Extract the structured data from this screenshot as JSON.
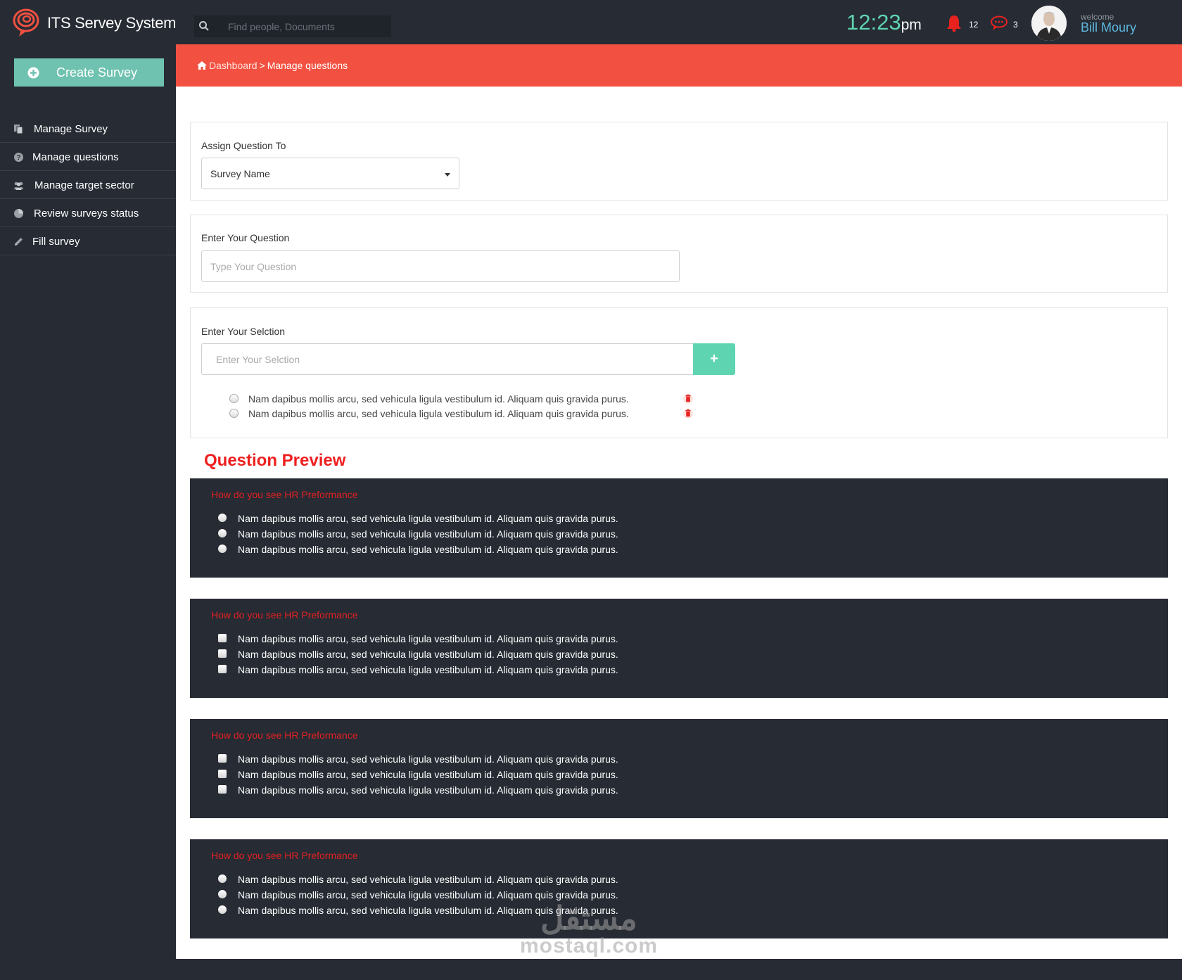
{
  "header": {
    "brand": "ITS Servey System",
    "search_placeholder": "Find people, Documents",
    "clock_time": "12:23",
    "clock_ampm": "pm",
    "notifications_count": "12",
    "messages_count": "3",
    "welcome_label": "welcome",
    "user_name": "Bill Moury"
  },
  "sidebar": {
    "create_label": "Create Survey",
    "items": [
      {
        "label": "Manage Survey",
        "icon": "copy-icon"
      },
      {
        "label": "Manage questions",
        "icon": "question-circle-icon"
      },
      {
        "label": "Manage target sector",
        "icon": "users-icon"
      },
      {
        "label": "Review surveys status",
        "icon": "pie-chart-icon"
      },
      {
        "label": "Fill survey",
        "icon": "pencil-icon"
      }
    ]
  },
  "breadcrumb": {
    "home": "Dashboard",
    "separator": ">",
    "current": "Manage questions"
  },
  "form": {
    "assign_label": "Assign Question To",
    "assign_value": "Survey Name",
    "question_label": "Enter Your Question",
    "question_placeholder": "Type Your Question",
    "selection_label": "Enter Your Selction",
    "selection_placeholder": "Enter Your Selction",
    "add_label": "+",
    "options": [
      "Nam dapibus mollis arcu, sed vehicula ligula vestibulum id. Aliquam quis gravida purus.",
      "Nam dapibus mollis arcu, sed vehicula ligula vestibulum id. Aliquam quis gravida purus."
    ]
  },
  "preview": {
    "title": "Question Preview",
    "cards": [
      {
        "title": "How do you see HR Preformance",
        "type": "radio",
        "options": [
          "Nam dapibus mollis arcu, sed vehicula ligula vestibulum id. Aliquam quis gravida purus.",
          "Nam dapibus mollis arcu, sed vehicula ligula vestibulum id. Aliquam quis gravida purus.",
          "Nam dapibus mollis arcu, sed vehicula ligula vestibulum id. Aliquam quis gravida purus."
        ]
      },
      {
        "title": "How do you see HR Preformance",
        "type": "checkbox",
        "options": [
          "Nam dapibus mollis arcu, sed vehicula ligula vestibulum id. Aliquam quis gravida purus.",
          "Nam dapibus mollis arcu, sed vehicula ligula vestibulum id. Aliquam quis gravida purus.",
          "Nam dapibus mollis arcu, sed vehicula ligula vestibulum id. Aliquam quis gravida purus."
        ]
      },
      {
        "title": "How do you see HR Preformance",
        "type": "checkbox",
        "options": [
          "Nam dapibus mollis arcu, sed vehicula ligula vestibulum id. Aliquam quis gravida purus.",
          "Nam dapibus mollis arcu, sed vehicula ligula vestibulum id. Aliquam quis gravida purus.",
          "Nam dapibus mollis arcu, sed vehicula ligula vestibulum id. Aliquam quis gravida purus."
        ]
      },
      {
        "title": "How do you see HR Preformance",
        "type": "radio",
        "options": [
          "Nam dapibus mollis arcu, sed vehicula ligula vestibulum id. Aliquam quis gravida purus.",
          "Nam dapibus mollis arcu, sed vehicula ligula vestibulum id. Aliquam quis gravida purus.",
          "Nam dapibus mollis arcu, sed vehicula ligula vestibulum id. Aliquam quis gravida purus."
        ]
      }
    ]
  },
  "watermark": {
    "arabic": "مستقل",
    "latin": "mostaql.com"
  },
  "colors": {
    "accent": "#5fd4b0",
    "danger": "#f25141",
    "dark": "#262b34",
    "link": "#5fb8e0"
  }
}
